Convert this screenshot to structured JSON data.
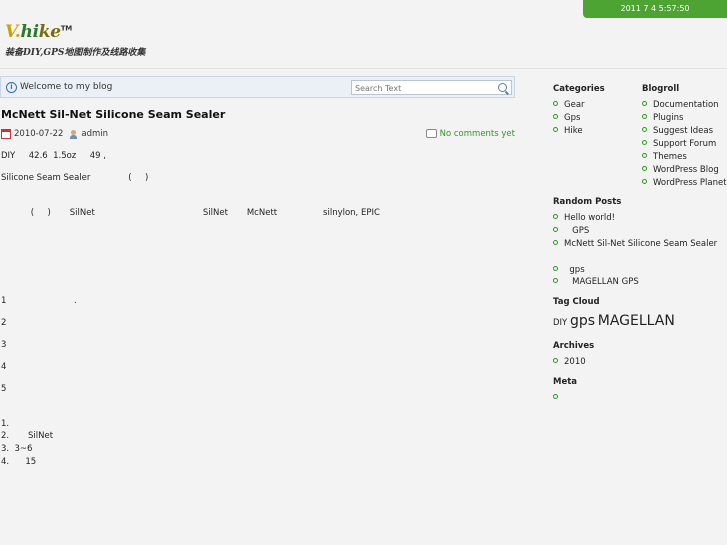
{
  "header": {
    "datetime": "2011 7 4   5:57:50",
    "logo_mark_v": "V.",
    "logo_mark_hi": "hi",
    "logo_mark_ke": "ke",
    "logo_tm": "TM",
    "tagline": "装备DIY,GPS地图制作及线路收集"
  },
  "welcome": {
    "text": "Welcome to my blog",
    "search_placeholder": "Search Text"
  },
  "post": {
    "title": "McNett Sil-Net Silicone Seam Sealer",
    "date": "2010-07-22",
    "author": "admin",
    "comments": "No comments yet",
    "lines": [
      "DIY     42.6  1.5oz     49 ,",
      "Silicone Seam Sealer              (     )",
      "           (     )       SilNet                                        SilNet       McNett                 silnylon, EPIC",
      "1                         .",
      "2",
      "3",
      "4",
      "5",
      "1.",
      "2.       SilNet",
      "3.  3~6",
      "4.      15"
    ]
  },
  "sidebar": {
    "categories_title": "Categories",
    "categories": [
      "Gear",
      "Gps",
      "Hike"
    ],
    "blogroll_title": "Blogroll",
    "blogroll": [
      "Documentation",
      "Plugins",
      "Suggest Ideas",
      "Support Forum",
      "Themes",
      "WordPress Blog",
      "WordPress Planet"
    ],
    "random_title": "Random Posts",
    "random_posts": [
      "Hello world!",
      "   GPS",
      "McNett Sil-Net Silicone Seam Sealer"
    ],
    "extra_posts": [
      "  gps",
      "   MAGELLAN GPS"
    ],
    "tagcloud_title": "Tag Cloud",
    "tags": [
      {
        "label": "DIY",
        "size": "small"
      },
      {
        "label": "gps",
        "size": "big"
      },
      {
        "label": "MAGELLAN",
        "size": "big"
      }
    ],
    "archives_title": "Archives",
    "archives": [
      "2010"
    ],
    "meta_title": "Meta",
    "meta_items": [
      ""
    ]
  },
  "colors": {
    "accent_green": "#4ea433",
    "link_green": "#2e9a21",
    "welcome_bg": "#eaf0f6"
  },
  "icons": {
    "info": "info-icon",
    "search": "search-icon",
    "calendar": "calendar-icon",
    "user": "user-icon",
    "comment": "comment-bubble-icon",
    "bullet": "bullet-icon"
  }
}
